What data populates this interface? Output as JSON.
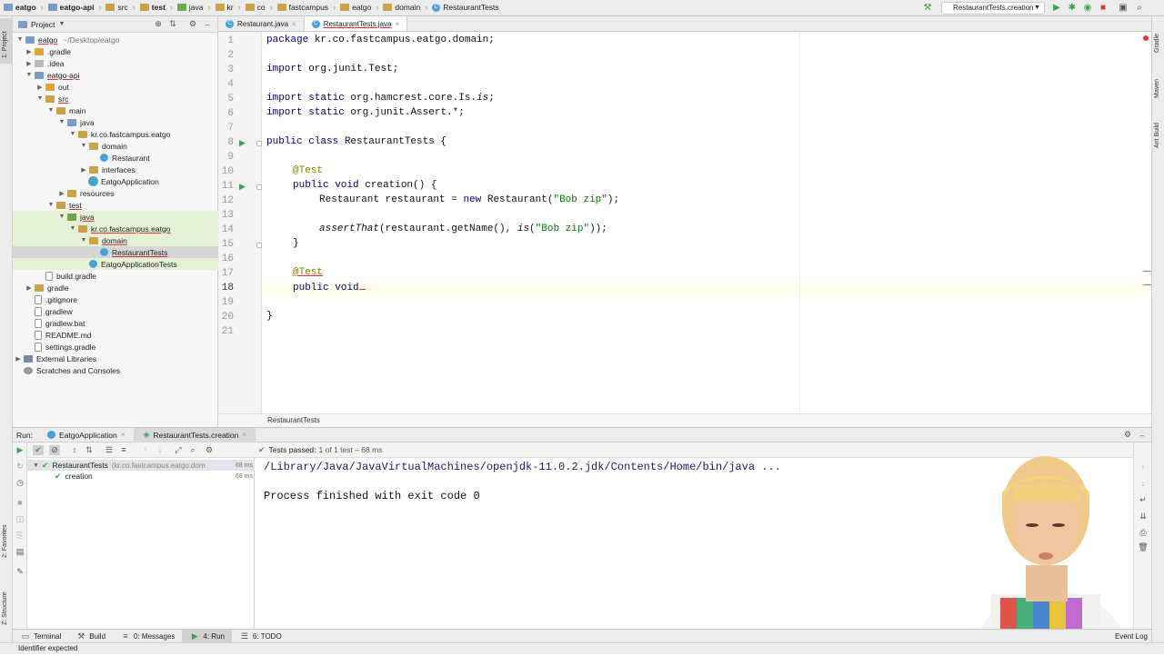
{
  "breadcrumbs": [
    "eatgo",
    "eatgo-api",
    "src",
    "test",
    "java",
    "kr",
    "co",
    "fastcampus",
    "eatgo",
    "domain",
    "RestaurantTests"
  ],
  "run_config": "RestaurantTests.creation",
  "left_stripe": {
    "project": "1: Project",
    "favorites": "2: Favorites",
    "structure": "Z: Structure"
  },
  "right_stripe": {
    "gradle": "Gradle",
    "maven": "Maven",
    "ant": "Ant Build"
  },
  "project_panel": {
    "title": "Project",
    "tree": [
      {
        "label": "eatgo",
        "hint": "~/Desktop/eatgo"
      },
      {
        "label": ".gradle"
      },
      {
        "label": ".idea"
      },
      {
        "label": "eatgo-api"
      },
      {
        "label": "out"
      },
      {
        "label": "src"
      },
      {
        "label": "main"
      },
      {
        "label": "java"
      },
      {
        "label": "kr.co.fastcampus.eatgo"
      },
      {
        "label": "domain"
      },
      {
        "label": "Restaurant"
      },
      {
        "label": "interfaces"
      },
      {
        "label": "EatgoApplication"
      },
      {
        "label": "resources"
      },
      {
        "label": "test"
      },
      {
        "label": "java"
      },
      {
        "label": "kr.co.fastcampus.eatgo"
      },
      {
        "label": "domain"
      },
      {
        "label": "RestaurantTests"
      },
      {
        "label": "EatgoApplicationTests"
      },
      {
        "label": "build.gradle"
      },
      {
        "label": "gradle"
      },
      {
        "label": ".gitignore"
      },
      {
        "label": "gradlew"
      },
      {
        "label": "gradlew.bat"
      },
      {
        "label": "README.md"
      },
      {
        "label": "settings.gradle"
      },
      {
        "label": "External Libraries"
      },
      {
        "label": "Scratches and Consoles"
      }
    ]
  },
  "editor_tabs": [
    "Restaurant.java",
    "RestaurantTests.java"
  ],
  "code_lines": {
    "l1": [
      "package",
      " kr.co.fastcampus.eatgo.domain;"
    ],
    "l3": [
      "import",
      " org.junit.Test;"
    ],
    "l5": [
      "import static",
      " org.hamcrest.core.Is.",
      "is",
      ";"
    ],
    "l6": [
      "import static",
      " org.junit.Assert.*;"
    ],
    "l8": [
      "public class",
      " RestaurantTests {"
    ],
    "l10": "@Test",
    "l11": [
      "public void",
      " creation() {"
    ],
    "l12": [
      "Restaurant restaurant = ",
      "new",
      " Restaurant(",
      "\"Bob zip\"",
      ");"
    ],
    "l14": [
      "assertThat",
      "(restaurant.getName(), ",
      "is",
      "(",
      "\"Bob zip\"",
      "));"
    ],
    "l15": "}",
    "l17": "@Test",
    "l18": "public void",
    "l20": "}"
  },
  "line_numbers": [
    "1",
    "2",
    "3",
    "4",
    "5",
    "6",
    "7",
    "8",
    "9",
    "10",
    "11",
    "12",
    "13",
    "14",
    "15",
    "16",
    "17",
    "18",
    "19",
    "20",
    "21"
  ],
  "editor_breadcrumb": "RestaurantTests",
  "run_panel": {
    "label": "Run:",
    "tabs": [
      "EatgoApplication",
      "RestaurantTests.creation"
    ],
    "tests_passed": "Tests passed:",
    "tests_summary": "1 of 1 test – 68 ms",
    "tree": [
      {
        "label": "RestaurantTests",
        "hint": "(kr.co.fastcampus.eatgo.dom",
        "time": "68 ms"
      },
      {
        "label": "creation",
        "time": "68 ms"
      }
    ],
    "console": [
      "/Library/Java/JavaVirtualMachines/openjdk-11.0.2.jdk/Contents/Home/bin/java ...",
      "Process finished with exit code 0"
    ]
  },
  "bottom_tabs": [
    "Terminal",
    "Build",
    "0: Messages",
    "4: Run",
    "6: TODO"
  ],
  "event_log": "Event Log",
  "status_message": "Identifier expected"
}
